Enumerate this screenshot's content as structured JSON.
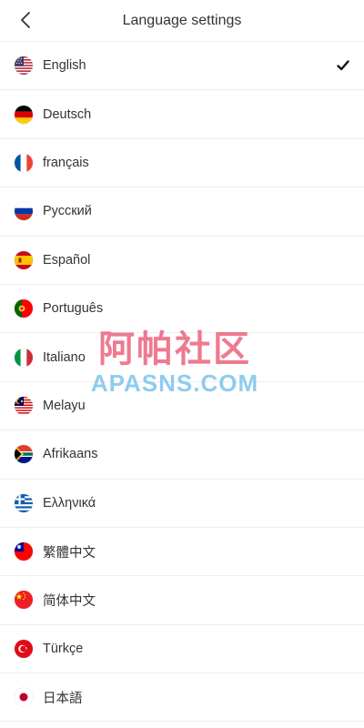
{
  "header": {
    "title": "Language settings",
    "back_icon": "chevron-left-icon"
  },
  "languages": [
    {
      "label": "English",
      "flag": "us-flag-icon",
      "selected": true
    },
    {
      "label": "Deutsch",
      "flag": "de-flag-icon",
      "selected": false
    },
    {
      "label": "français",
      "flag": "fr-flag-icon",
      "selected": false
    },
    {
      "label": "Русский",
      "flag": "ru-flag-icon",
      "selected": false
    },
    {
      "label": "Español",
      "flag": "es-flag-icon",
      "selected": false
    },
    {
      "label": "Português",
      "flag": "pt-flag-icon",
      "selected": false
    },
    {
      "label": "Italiano",
      "flag": "it-flag-icon",
      "selected": false
    },
    {
      "label": "Melayu",
      "flag": "my-flag-icon",
      "selected": false
    },
    {
      "label": "Afrikaans",
      "flag": "za-flag-icon",
      "selected": false
    },
    {
      "label": "Ελληνικά",
      "flag": "gr-flag-icon",
      "selected": false
    },
    {
      "label": "繁體中文",
      "flag": "tw-flag-icon",
      "selected": false
    },
    {
      "label": "简体中文",
      "flag": "cn-flag-icon",
      "selected": false
    },
    {
      "label": "Türkçe",
      "flag": "tr-flag-icon",
      "selected": false
    },
    {
      "label": "日本語",
      "flag": "jp-flag-icon",
      "selected": false
    }
  ],
  "watermark": {
    "line1": "阿帕社区",
    "line2": "APASNS.COM"
  },
  "colors": {
    "divider": "#eeeeee",
    "text": "#333333",
    "watermark_red": "#e84664",
    "watermark_blue": "#6ebeeb"
  }
}
